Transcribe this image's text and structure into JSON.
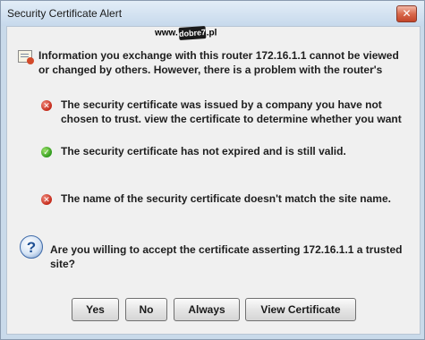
{
  "window": {
    "title": "Security Certificate Alert",
    "close_label": "✕"
  },
  "watermark": {
    "prefix": "www.",
    "logo_text": "dobre7",
    "suffix": ".pl"
  },
  "info": {
    "icon": "certificate-icon",
    "line1": "Information you exchange with this router 172.16.1.1 cannot be viewed",
    "line2": "or changed by others. However, there is a problem with the router's"
  },
  "checks": [
    {
      "status": "error",
      "icon": "error-icon",
      "line1": "The security certificate was issued by a company you have not",
      "line2": "chosen to trust. view the certificate to determine whether you want"
    },
    {
      "status": "ok",
      "icon": "check-icon",
      "line1": "The security certificate has not expired and is still valid."
    },
    {
      "status": "error",
      "icon": "error-icon",
      "line1": "The name of the security certificate doesn't match the site name."
    }
  ],
  "question": {
    "icon": "question-icon",
    "line1": "Are you willing to accept the certificate asserting 172.16.1.1 a trusted",
    "line2": "site?"
  },
  "buttons": {
    "yes": "Yes",
    "no": "No",
    "always": "Always",
    "view_certificate": "View Certificate"
  },
  "colors": {
    "error": "#c42a1a",
    "ok": "#2f9a1c",
    "close": "#c2452a",
    "frame": "#c9daea"
  }
}
